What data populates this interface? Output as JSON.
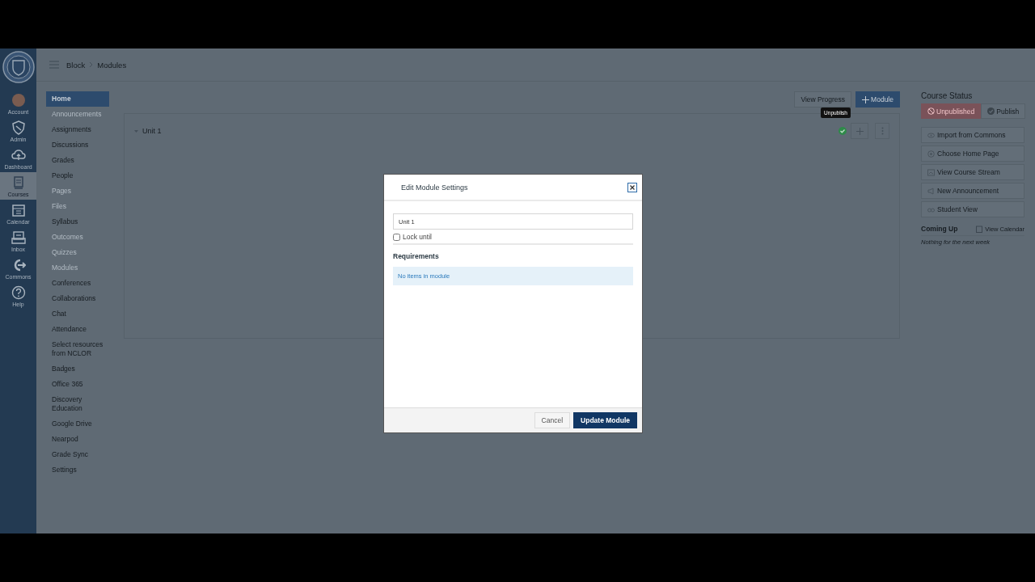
{
  "global_nav": {
    "items": [
      {
        "label": "Account",
        "kind": "avatar",
        "selected": false
      },
      {
        "label": "Admin",
        "kind": "shield",
        "selected": false
      },
      {
        "label": "Dashboard",
        "kind": "cloud",
        "selected": false
      },
      {
        "label": "Courses",
        "kind": "book",
        "selected": true
      },
      {
        "label": "Calendar",
        "kind": "calendar",
        "selected": false
      },
      {
        "label": "Inbox",
        "kind": "inbox",
        "selected": false
      },
      {
        "label": "Commons",
        "kind": "arrow",
        "selected": false
      },
      {
        "label": "Help",
        "kind": "help",
        "selected": false
      }
    ]
  },
  "breadcrumb": [
    "Block",
    "Modules"
  ],
  "course_nav": [
    {
      "label": "Home",
      "selected": true,
      "disabled": false
    },
    {
      "label": "Announcements",
      "selected": false,
      "disabled": true
    },
    {
      "label": "Assignments",
      "selected": false,
      "disabled": false
    },
    {
      "label": "Discussions",
      "selected": false,
      "disabled": false
    },
    {
      "label": "Grades",
      "selected": false,
      "disabled": false
    },
    {
      "label": "People",
      "selected": false,
      "disabled": false
    },
    {
      "label": "Pages",
      "selected": false,
      "disabled": true
    },
    {
      "label": "Files",
      "selected": false,
      "disabled": true
    },
    {
      "label": "Syllabus",
      "selected": false,
      "disabled": false
    },
    {
      "label": "Outcomes",
      "selected": false,
      "disabled": true
    },
    {
      "label": "Quizzes",
      "selected": false,
      "disabled": true
    },
    {
      "label": "Modules",
      "selected": false,
      "disabled": true
    },
    {
      "label": "Conferences",
      "selected": false,
      "disabled": false
    },
    {
      "label": "Collaborations",
      "selected": false,
      "disabled": false
    },
    {
      "label": "Chat",
      "selected": false,
      "disabled": false
    },
    {
      "label": "Attendance",
      "selected": false,
      "disabled": false
    },
    {
      "label": "Select resources from NCLOR",
      "selected": false,
      "disabled": false
    },
    {
      "label": "Badges",
      "selected": false,
      "disabled": false
    },
    {
      "label": "Office 365",
      "selected": false,
      "disabled": false
    },
    {
      "label": "Discovery Education",
      "selected": false,
      "disabled": false
    },
    {
      "label": "Google Drive",
      "selected": false,
      "disabled": false
    },
    {
      "label": "Nearpod",
      "selected": false,
      "disabled": false
    },
    {
      "label": "Grade Sync",
      "selected": false,
      "disabled": false
    },
    {
      "label": "Settings",
      "selected": false,
      "disabled": false
    }
  ],
  "toolbar": {
    "buttons": [
      {
        "label": "View Progress",
        "kind": "secondary"
      },
      {
        "label": "Module",
        "kind": "primary"
      }
    ]
  },
  "module": {
    "title": "Unit 1",
    "expanded": true,
    "published": true,
    "tooltip": "Unpublish"
  },
  "course_status": {
    "title": "Course Status",
    "options": [
      {
        "label": "Unpublished",
        "selected": true
      },
      {
        "label": "Publish",
        "selected": false
      }
    ]
  },
  "sidebar_buttons": [
    {
      "label": "Import from Commons",
      "kind": "commons"
    },
    {
      "label": "Choose Home Page",
      "kind": "home"
    },
    {
      "label": "View Course Stream",
      "kind": "stream"
    },
    {
      "label": "New Announcement",
      "kind": "announce"
    },
    {
      "label": "Student View",
      "kind": "student"
    }
  ],
  "coming_up": {
    "title": "Coming Up",
    "link": "View Calendar",
    "empty": "Nothing for the next week"
  },
  "dialog": {
    "title": "Edit Module Settings",
    "name_value": "Unit 1",
    "lock": {
      "label": "Lock until",
      "checked": false
    },
    "requirements_title": "Requirements",
    "requirements_empty": "No items in module",
    "buttons": [
      {
        "label": "Cancel",
        "kind": "secondary"
      },
      {
        "label": "Update Module",
        "kind": "primary"
      }
    ]
  }
}
